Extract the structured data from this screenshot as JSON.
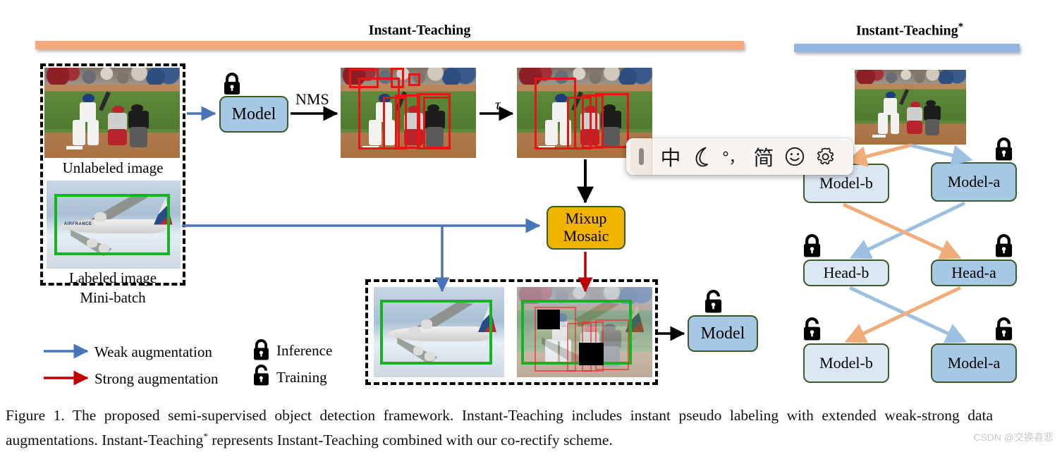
{
  "figure": {
    "left_panel_title": "Instant-Teaching",
    "right_panel_title": "Instant-Teaching",
    "right_panel_title_star": "*",
    "labels": {
      "unlabeled_image": "Unlabeled image",
      "labeled_image": "Labeled image",
      "mini_batch": "Mini-batch",
      "nms": "NMS",
      "tau": "τ"
    },
    "boxes": {
      "model_top": "Model",
      "mixup_mosaic_line1": "Mixup",
      "mixup_mosaic_line2": "Mosaic",
      "model_bottom": "Model",
      "model_b_top": "Model-b",
      "model_a_top": "Model-a",
      "head_b": "Head-b",
      "head_a": "Head-a",
      "model_b_bottom": "Model-b",
      "model_a_bottom": "Model-a"
    },
    "legend": {
      "weak": "Weak augmentation",
      "strong": "Strong augmentation",
      "inference": "Inference",
      "training": "Training",
      "weak_arrow_icon": "blue-arrow-icon",
      "strong_arrow_icon": "red-arrow-icon",
      "inference_icon": "closed-lock-icon",
      "training_icon": "open-lock-icon"
    },
    "colors": {
      "orange_bar": "#f4a97c",
      "blue_bar": "#92b5df",
      "box_blue": "#a6c8e5",
      "box_light_blue": "#dbe8f3",
      "box_gold": "#f0b400",
      "box_border_green": "#3b5c2a",
      "weak_arrow": "#4a74b8",
      "strong_arrow": "#c00000",
      "corectify_orange": "#f0ad7a",
      "corectify_blue": "#9cc0e0",
      "detection_box_red": "#e81313",
      "gt_box_green": "#16b422"
    }
  },
  "caption": {
    "text_part1": "Figure 1. The proposed semi-supervised object detection framework.  Instant-Teaching includes instant pseudo labeling with extended weak-strong data augmentations. Instant-Teaching",
    "star": "*",
    "text_part2": " represents Instant-Teaching combined with our co-rectify scheme."
  },
  "watermark": {
    "text": "CSDN @交换喜悲"
  },
  "ime_toolbar": {
    "handle_icon": "drag-handle-icon",
    "items": [
      {
        "label": "中",
        "name": "chinese-english-toggle",
        "icon": "chinese-mode-icon"
      },
      {
        "label": "",
        "name": "crescent-moon-button",
        "icon": "crescent-moon-icon"
      },
      {
        "label": "°，",
        "name": "punctuation-toggle",
        "icon": "punctuation-icon"
      },
      {
        "label": "简",
        "name": "simplified-traditional-toggle",
        "icon": "simplified-chinese-icon"
      },
      {
        "label": "",
        "name": "emoji-button",
        "icon": "smiley-icon"
      },
      {
        "label": "",
        "name": "settings-button",
        "icon": "gear-icon"
      }
    ]
  }
}
